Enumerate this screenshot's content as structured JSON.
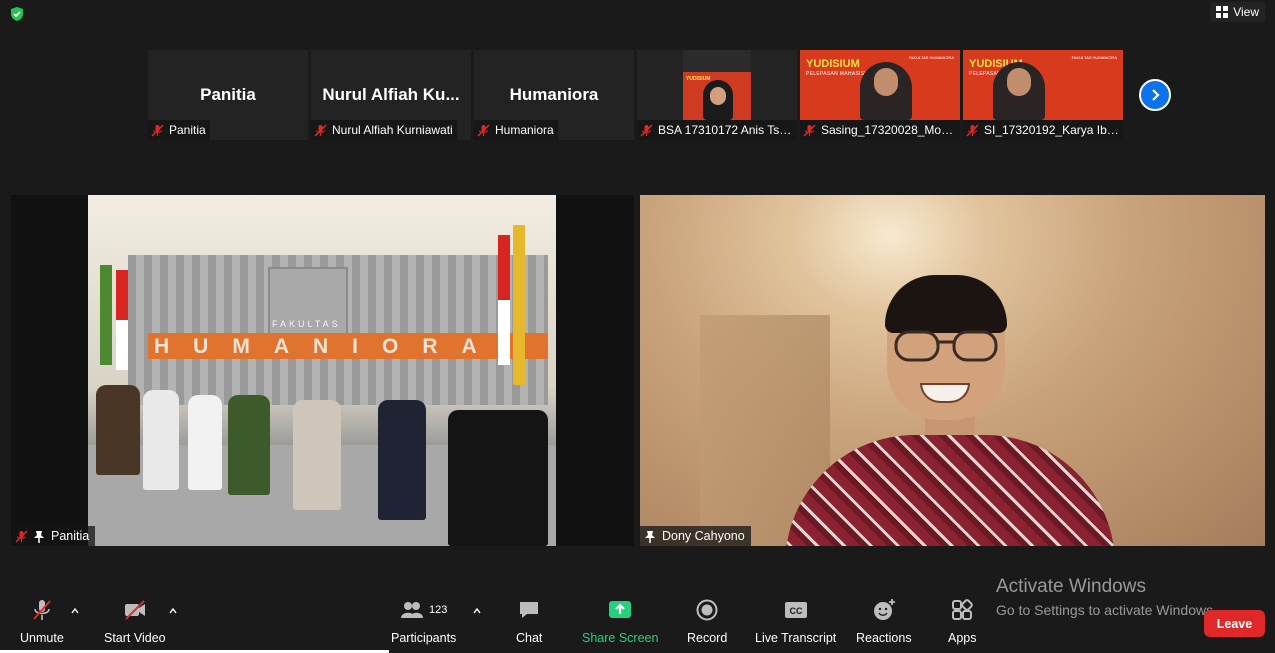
{
  "header": {
    "security_icon": "shield-check-icon",
    "view_label": "View"
  },
  "gallery": {
    "thumbnails": [
      {
        "big_name": "Panitia",
        "label": "Panitia",
        "video": false
      },
      {
        "big_name": "Nurul  Alfiah  Ku...",
        "label": "Nurul Alfiah Kurniawati",
        "video": false
      },
      {
        "big_name": "Humaniora",
        "label": "Humaniora",
        "video": false
      },
      {
        "big_name": "",
        "label": "BSA 17310172 Anis Tsa...",
        "video": true
      },
      {
        "big_name": "",
        "label": "Sasing_17320028_Moh...",
        "video": true
      },
      {
        "big_name": "",
        "label": "SI_17320192_Karya Ibn...",
        "video": true
      }
    ],
    "yudisium_title": "YUDISIUM",
    "yudisium_sub": "PELEPASAN MAHASISWA",
    "faculty_badge": "FAKULTAS HUMANIORA",
    "next_icon": "chevron-right-icon"
  },
  "main": {
    "left": {
      "label": "Panitia",
      "sign_faculty": "FAKULTAS",
      "sign_humaniora": "HUMANIORA"
    },
    "right": {
      "label": "Dony Cahyono"
    }
  },
  "watermark": {
    "title": "Activate Windows",
    "subtitle": "Go to Settings to activate Windows."
  },
  "toolbar": {
    "unmute": "Unmute",
    "start_video": "Start Video",
    "participants": "Participants",
    "participants_count": "123",
    "chat": "Chat",
    "share_screen": "Share Screen",
    "record": "Record",
    "live_transcript": "Live Transcript",
    "reactions": "Reactions",
    "apps": "Apps",
    "leave": "Leave",
    "colors": {
      "share": "#26d07c",
      "leave": "#e02828",
      "accent": "#0e72ed",
      "muted": "#e02828"
    }
  }
}
